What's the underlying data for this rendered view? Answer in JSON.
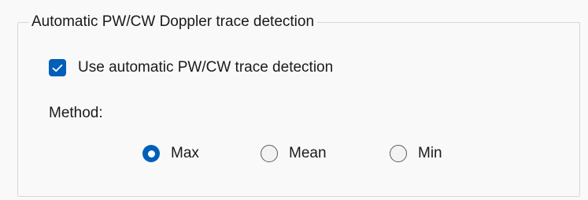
{
  "group": {
    "title": "Automatic PW/CW Doppler trace detection"
  },
  "auto_detect_checkbox": {
    "label": "Use automatic PW/CW trace detection",
    "checked": true,
    "icon": "checkmark-icon"
  },
  "method": {
    "label": "Method:",
    "options": [
      {
        "label": "Max",
        "selected": true
      },
      {
        "label": "Mean",
        "selected": false
      },
      {
        "label": "Min",
        "selected": false
      }
    ]
  },
  "colors": {
    "accent": "#005fb8",
    "background": "#f9f9f9",
    "border": "#d7d7d7"
  }
}
